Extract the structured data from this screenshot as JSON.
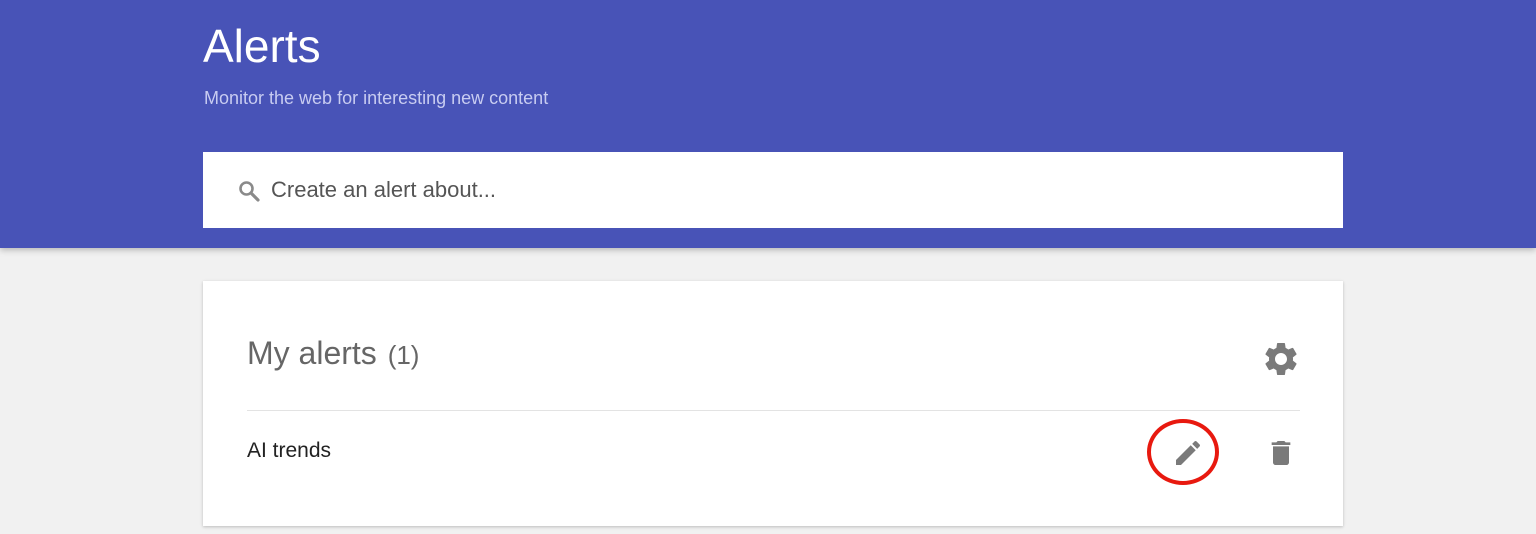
{
  "header": {
    "title": "Alerts",
    "subtitle": "Monitor the web for interesting new content",
    "background_color": "#4853b7"
  },
  "search": {
    "placeholder": "Create an alert about...",
    "value": "",
    "icon": "search-icon"
  },
  "my_alerts": {
    "title": "My alerts",
    "count": "(1)",
    "settings_icon": "gear-icon",
    "items": [
      {
        "name": "AI trends",
        "edit_icon": "pencil-icon",
        "delete_icon": "trash-icon"
      }
    ]
  },
  "annotation": {
    "highlight_color": "#e8190f"
  }
}
